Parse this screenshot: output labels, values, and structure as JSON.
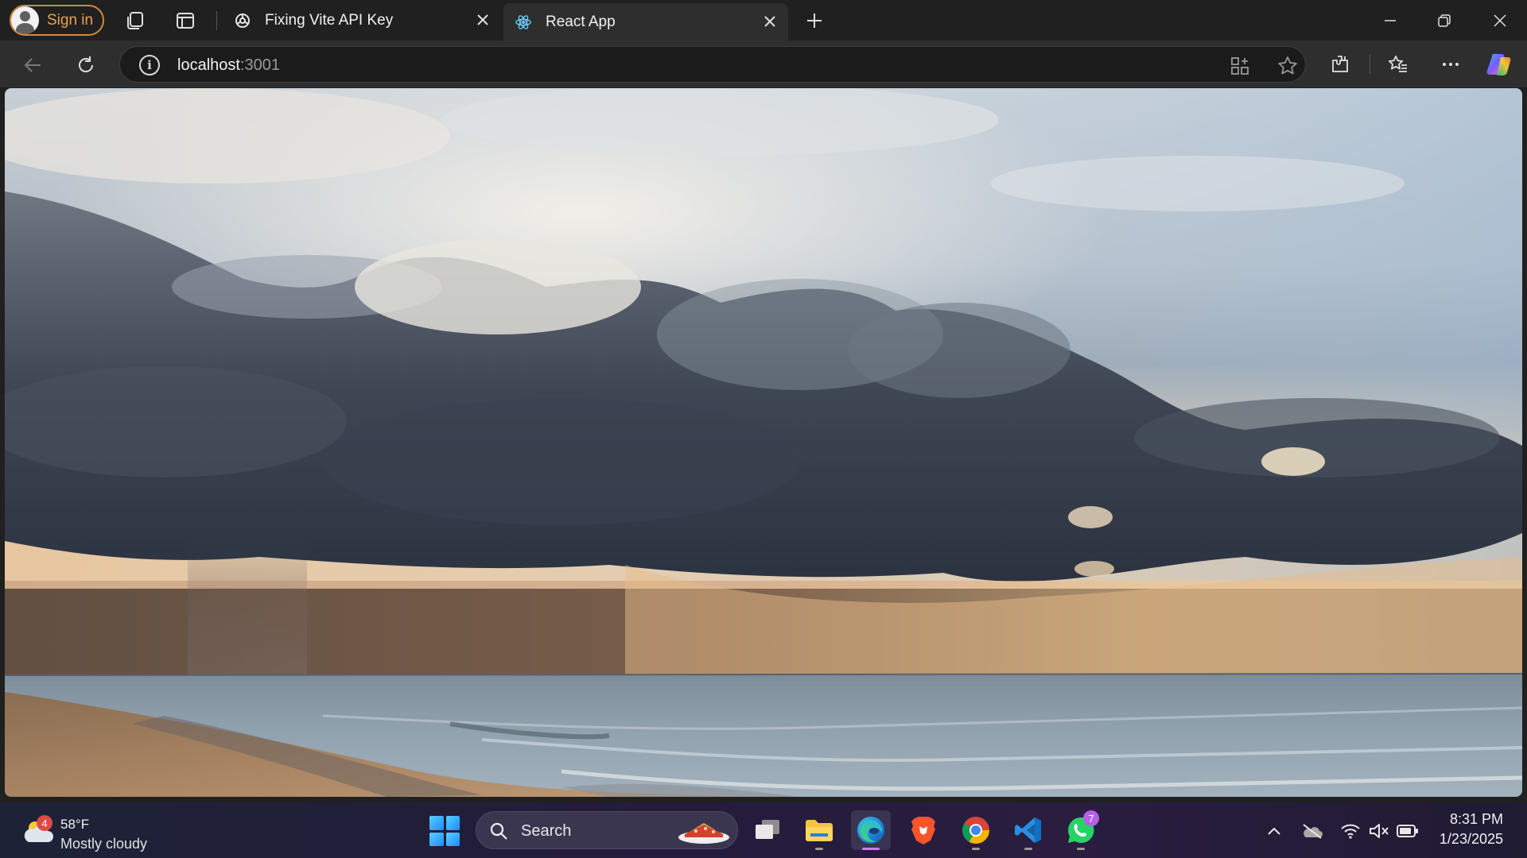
{
  "browser": {
    "profile_label": "Sign in",
    "tabs": [
      {
        "title": "Fixing Vite API Key",
        "icon": "openai-icon"
      },
      {
        "title": "React App",
        "icon": "react-icon",
        "active": true
      }
    ],
    "address": {
      "host": "localhost",
      "port": ":3001"
    }
  },
  "page": {
    "hero_image": "stormy-beach-seascape"
  },
  "taskbar": {
    "weather": {
      "temp": "58°F",
      "condition": "Mostly cloudy",
      "badge": "4"
    },
    "search_placeholder": "Search",
    "whatsapp_badge": "7",
    "clock": {
      "time": "8:31 PM",
      "date": "1/23/2025"
    }
  },
  "colors": {
    "accent_signin": "#f0a04b",
    "taskbar_active": "#d07aff"
  }
}
